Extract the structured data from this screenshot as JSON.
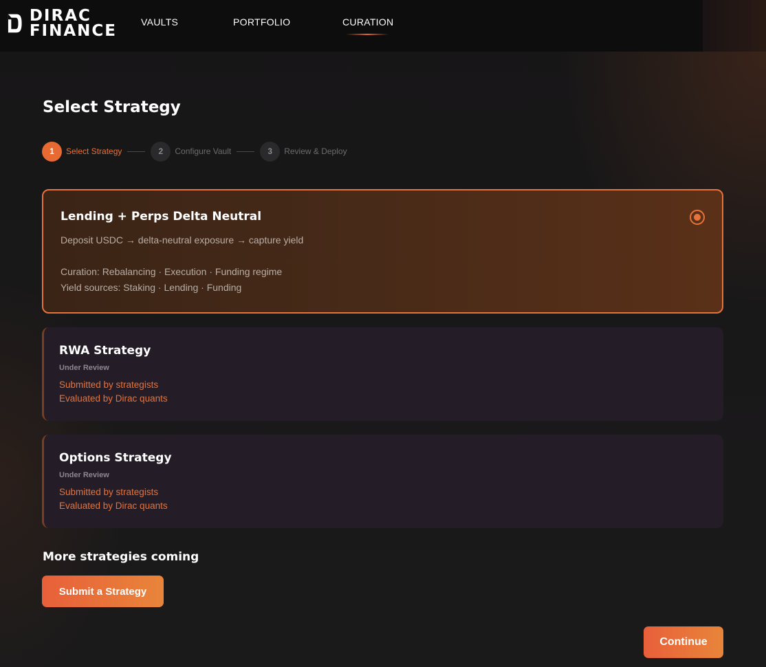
{
  "brand": {
    "line1": "DIRAC",
    "line2": "FINANCE",
    "accent_color": "#e86a33"
  },
  "nav": {
    "items": [
      {
        "label": "VAULTS"
      },
      {
        "label": "PORTFOLIO"
      },
      {
        "label": "CURATION",
        "active": true
      }
    ]
  },
  "page": {
    "title": "Select Strategy"
  },
  "stepper": {
    "steps": [
      {
        "number": "1",
        "label": "Select Strategy",
        "state": "active"
      },
      {
        "number": "2",
        "label": "Configure Vault",
        "state": "inactive"
      },
      {
        "number": "3",
        "label": "Review & Deploy",
        "state": "inactive"
      }
    ]
  },
  "strategies": [
    {
      "title": "Lending + Perps Delta Neutral",
      "description": "Deposit USDC → delta-neutral exposure → capture yield",
      "curation": "Curation: Rebalancing · Execution · Funding regime",
      "yield_sources": "Yield sources: Staking · Lending · Funding",
      "selected": true
    },
    {
      "title": "RWA Strategy",
      "status": "Under Review",
      "line1": "Submitted by strategists",
      "line2": "Evaluated by Dirac quants"
    },
    {
      "title": "Options Strategy",
      "status": "Under Review",
      "line1": "Submitted by strategists",
      "line2": "Evaluated by Dirac quants"
    }
  ],
  "more": {
    "title": "More strategies coming",
    "submit_label": "Submit a Strategy"
  },
  "footer": {
    "continue_label": "Continue"
  }
}
